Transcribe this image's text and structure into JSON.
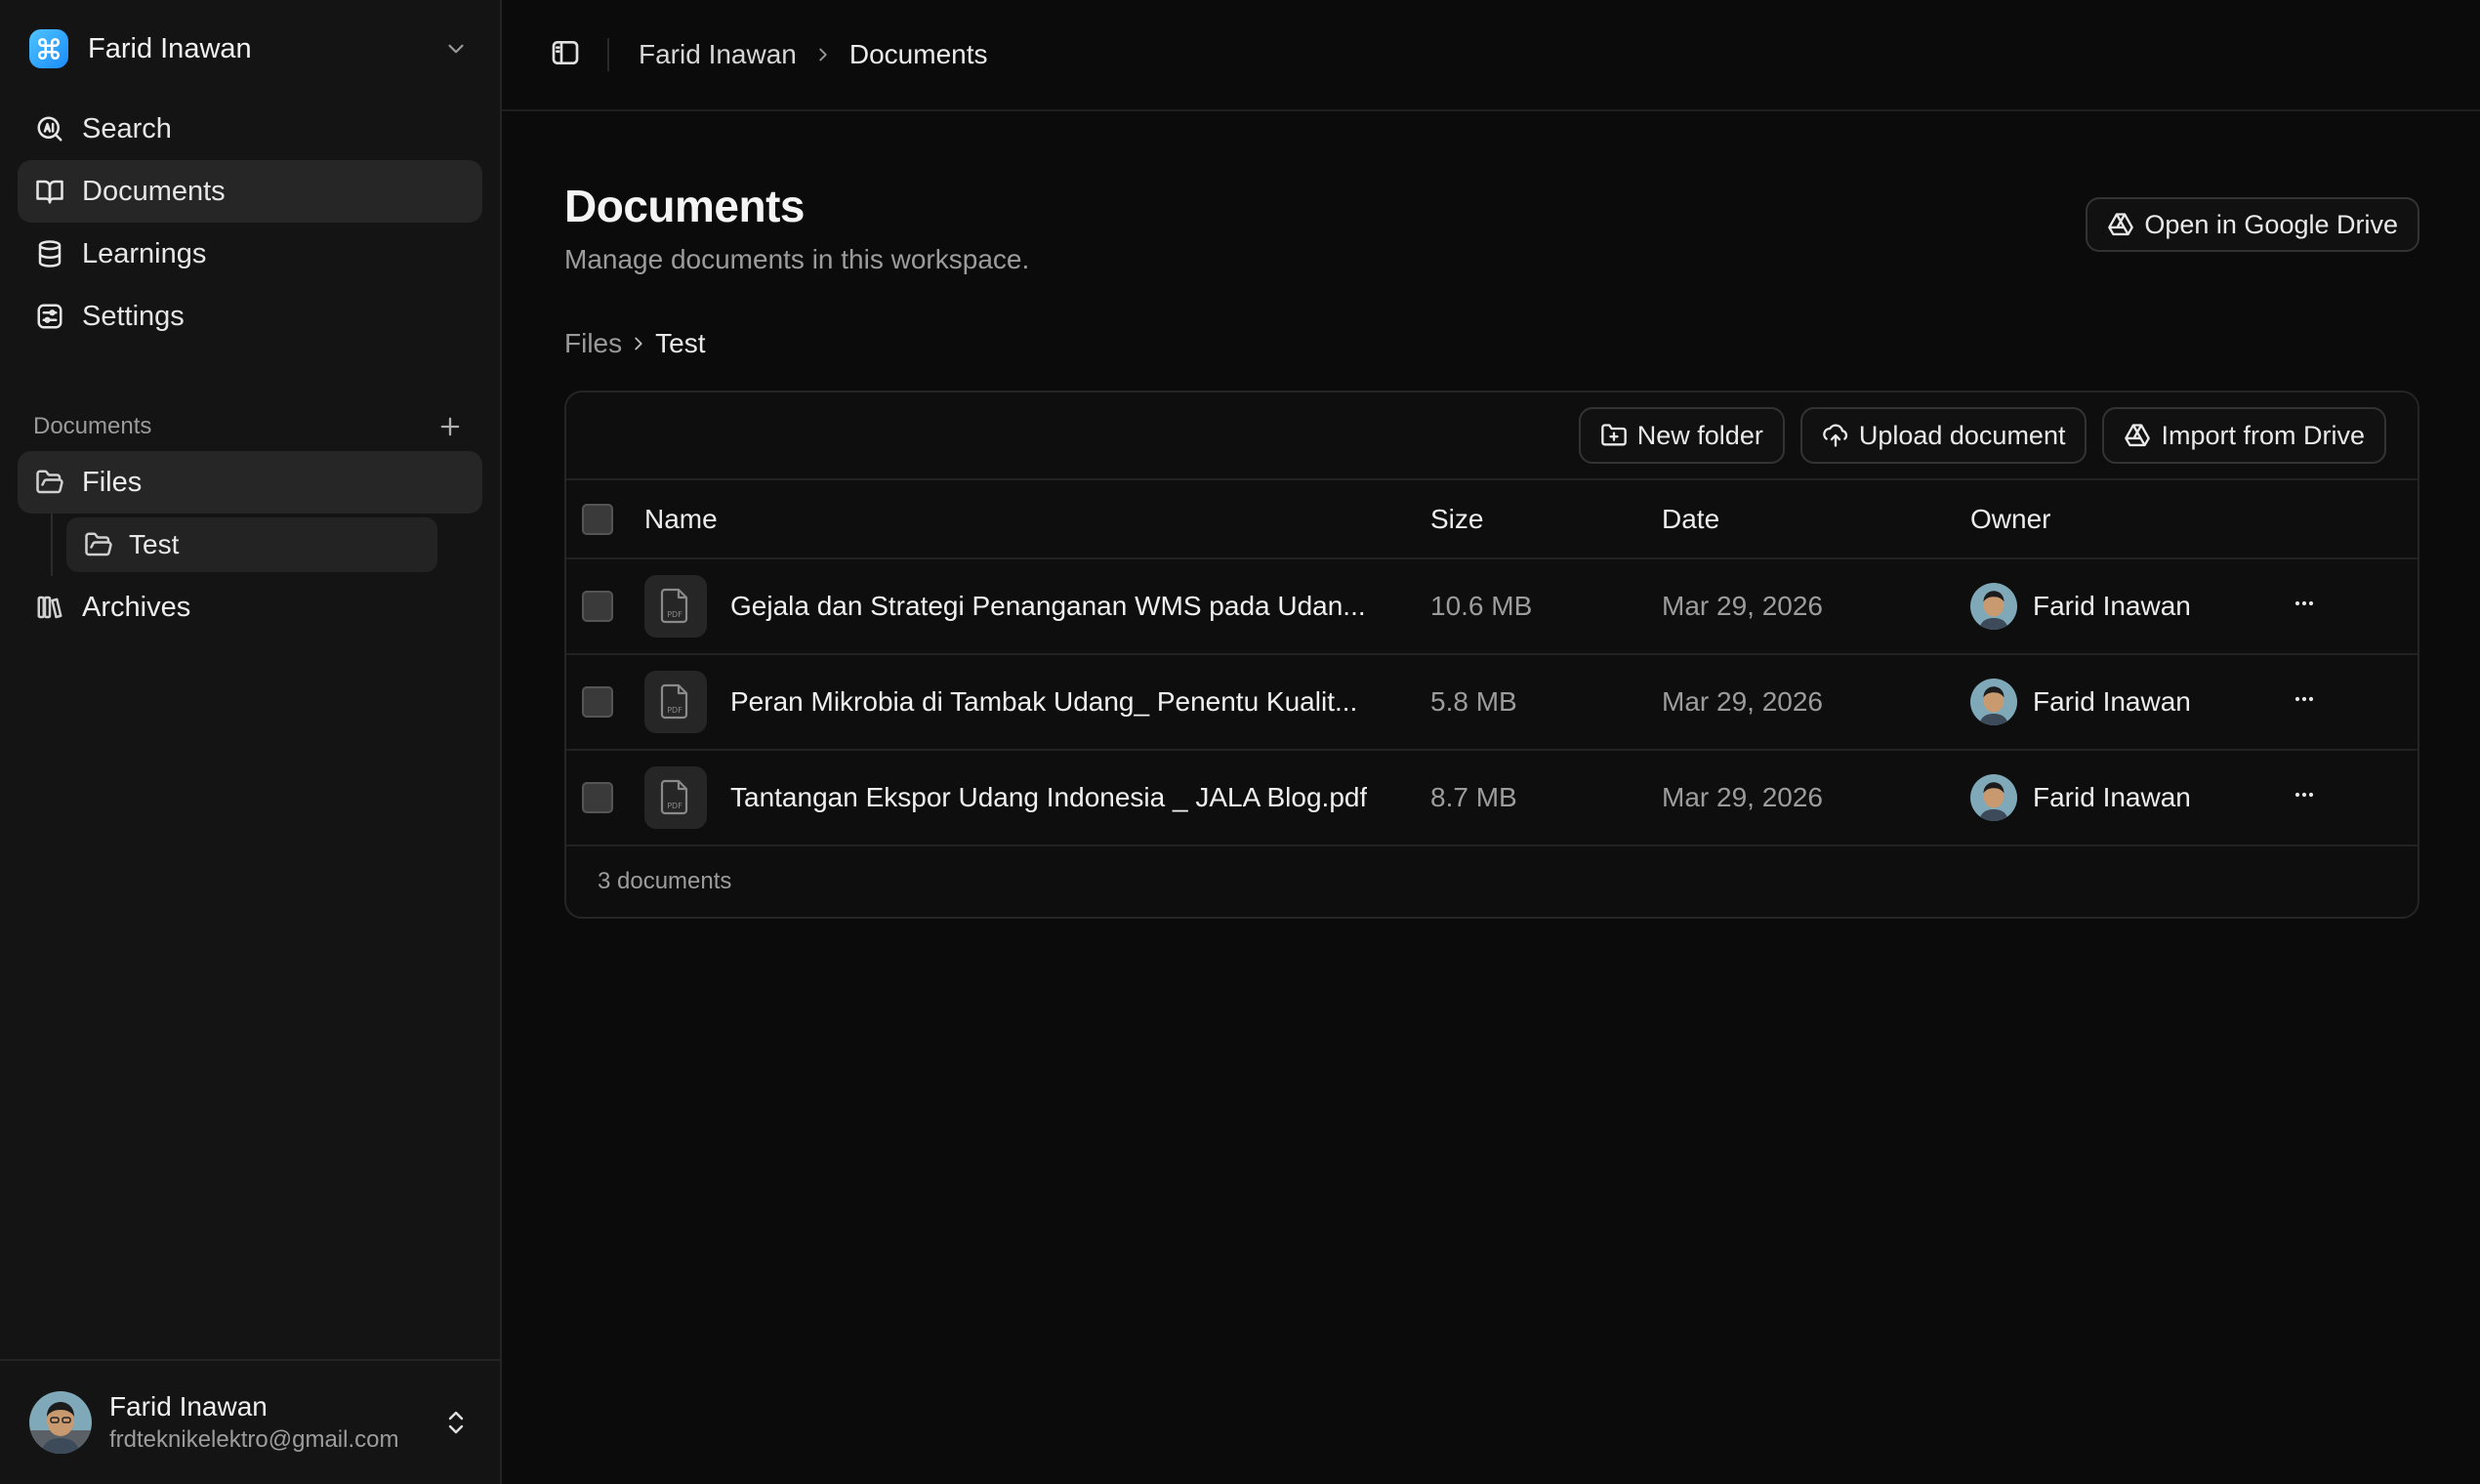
{
  "workspace": {
    "name": "Farid Inawan"
  },
  "nav": [
    {
      "label": "Search",
      "icon": "ai-search-icon"
    },
    {
      "label": "Documents",
      "icon": "book-open-icon",
      "active": true
    },
    {
      "label": "Learnings",
      "icon": "database-icon"
    },
    {
      "label": "Settings",
      "icon": "settings-icon"
    }
  ],
  "docs_section": {
    "label": "Documents",
    "files": "Files",
    "test": "Test",
    "archives": "Archives"
  },
  "user": {
    "name": "Farid Inawan",
    "email": "frdteknikelektro@gmail.com"
  },
  "topbar": {
    "crumbs": [
      "Farid Inawan",
      "Documents"
    ]
  },
  "page": {
    "title": "Documents",
    "subtitle": "Manage documents in this workspace.",
    "drive_button": "Open in Google Drive"
  },
  "path": [
    "Files",
    "Test"
  ],
  "toolbar": {
    "new_folder": "New folder",
    "upload": "Upload document",
    "import": "Import from Drive"
  },
  "table": {
    "headers": {
      "name": "Name",
      "size": "Size",
      "date": "Date",
      "owner": "Owner"
    },
    "rows": [
      {
        "name": "Gejala dan Strategi Penanganan WMS pada Udan...",
        "size": "10.6 MB",
        "date": "Mar 29, 2026",
        "owner": "Farid Inawan"
      },
      {
        "name": "Peran Mikrobia di Tambak Udang_ Penentu Kualit...",
        "size": "5.8 MB",
        "date": "Mar 29, 2026",
        "owner": "Farid Inawan"
      },
      {
        "name": "Tantangan Ekspor Udang Indonesia _ JALA Blog.pdf",
        "size": "8.7 MB",
        "date": "Mar 29, 2026",
        "owner": "Farid Inawan"
      }
    ],
    "footer": "3 documents",
    "pdf_label": "PDF"
  }
}
